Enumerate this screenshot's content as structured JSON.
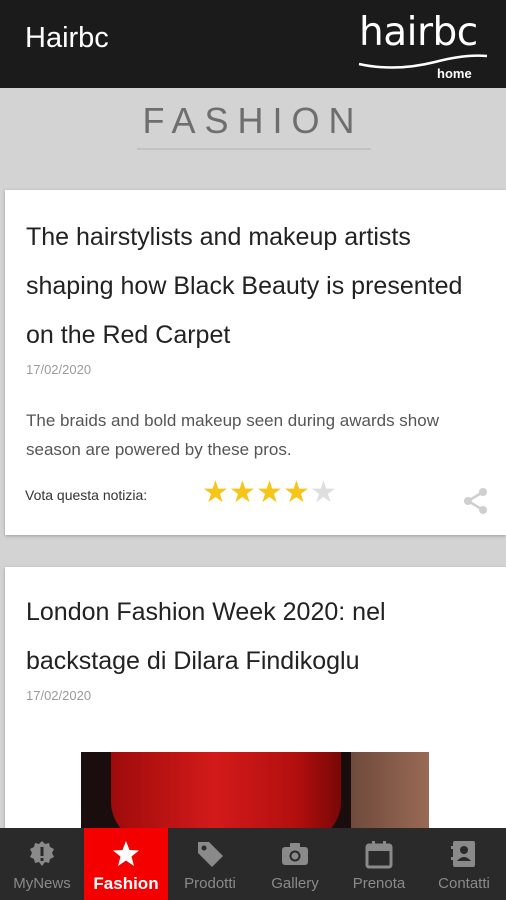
{
  "header": {
    "title": "Hairbc",
    "logo_text": "hairbc",
    "logo_home": "home"
  },
  "section": {
    "title": "FASHION"
  },
  "articles": [
    {
      "title": "The hairstylists and makeup artists shaping how Black Beauty is presented on the Red Carpet",
      "date": "17/02/2020",
      "excerpt": "The braids and bold makeup seen during awards show season are powered by these pros.",
      "rating_label": "Vota questa notizia:",
      "rating": 4,
      "rating_max": 5
    },
    {
      "title": "London Fashion Week 2020: nel backstage di Dilara Findikoglu",
      "date": "17/02/2020"
    }
  ],
  "tabs": [
    {
      "label": "MyNews",
      "icon": "alert-badge-icon"
    },
    {
      "label": "Fashion",
      "icon": "star-icon",
      "active": true
    },
    {
      "label": "Prodotti",
      "icon": "tag-icon"
    },
    {
      "label": "Gallery",
      "icon": "camera-icon"
    },
    {
      "label": "Prenota",
      "icon": "calendar-icon"
    },
    {
      "label": "Contatti",
      "icon": "contact-icon"
    }
  ],
  "colors": {
    "topbar": "#1b1b1b",
    "background": "#d3d3d3",
    "accent": "#f40000",
    "star_on": "#f5c518",
    "star_off": "#dedede"
  }
}
